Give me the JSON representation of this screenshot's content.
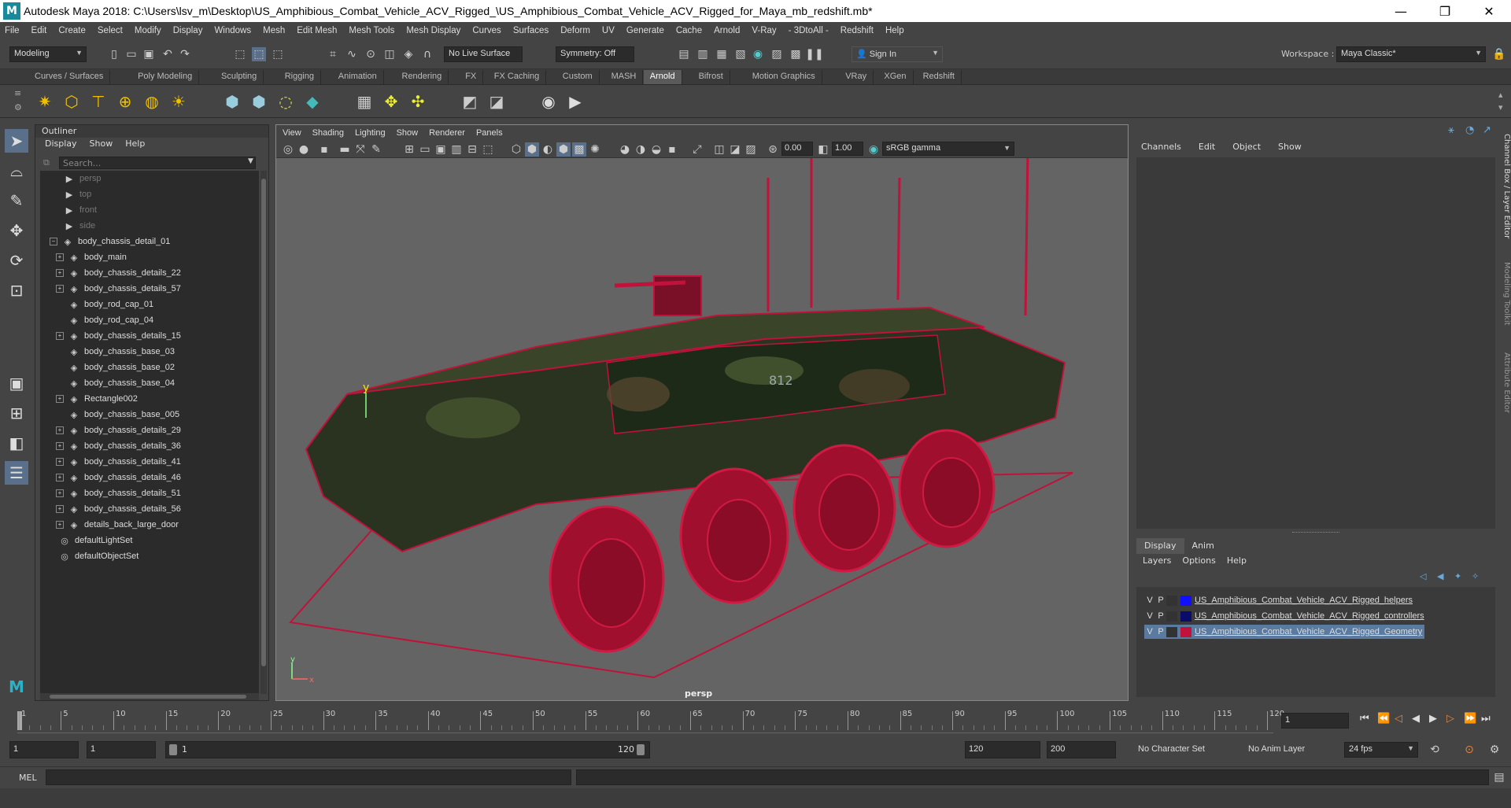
{
  "window": {
    "title": "Autodesk Maya 2018: C:\\Users\\lsv_m\\Desktop\\US_Amphibious_Combat_Vehicle_ACV_Rigged_\\US_Amphibious_Combat_Vehicle_ACV_Rigged_for_Maya_mb_redshift.mb*",
    "logo": "M",
    "minimize": "—",
    "restore": "❐",
    "close": "✕"
  },
  "menubar": [
    "File",
    "Edit",
    "Create",
    "Select",
    "Modify",
    "Display",
    "Windows",
    "Mesh",
    "Edit Mesh",
    "Mesh Tools",
    "Mesh Display",
    "Curves",
    "Surfaces",
    "Deform",
    "UV",
    "Generate",
    "Cache",
    "Arnold",
    "V-Ray",
    "- 3DtoAll -",
    "Redshift",
    "Help"
  ],
  "statusline": {
    "mode": "Modeling",
    "live_surface": "No Live Surface",
    "symmetry": "Symmetry: Off",
    "sign_in": "Sign In",
    "workspace_label": "Workspace :",
    "workspace_value": "Maya Classic*"
  },
  "shelf_tabs": [
    "Curves / Surfaces",
    "Poly Modeling",
    "Sculpting",
    "Rigging",
    "Animation",
    "Rendering",
    "FX",
    "FX Caching",
    "Custom",
    "MASH",
    "Arnold",
    "Bifrost",
    "Motion Graphics",
    "VRay",
    "XGen",
    "Redshift"
  ],
  "shelf_active": "Arnold",
  "outliner": {
    "title": "Outliner",
    "menu": [
      "Display",
      "Show",
      "Help"
    ],
    "search_placeholder": "Search...",
    "items": [
      {
        "label": "persp",
        "kind": "camera",
        "dim": true,
        "indent": 0,
        "expand": false
      },
      {
        "label": "top",
        "kind": "camera",
        "dim": true,
        "indent": 0,
        "expand": false
      },
      {
        "label": "front",
        "kind": "camera",
        "dim": true,
        "indent": 0,
        "expand": false
      },
      {
        "label": "side",
        "kind": "camera",
        "dim": true,
        "indent": 0,
        "expand": false
      },
      {
        "label": "body_chassis_detail_01",
        "kind": "group",
        "dim": false,
        "indent": 0,
        "expand": true,
        "expand_sign": "−"
      },
      {
        "label": "body_main",
        "kind": "group",
        "dim": false,
        "indent": 1,
        "expand": true,
        "expand_sign": "+"
      },
      {
        "label": "body_chassis_details_22",
        "kind": "group",
        "dim": false,
        "indent": 1,
        "expand": true,
        "expand_sign": "+"
      },
      {
        "label": "body_chassis_details_57",
        "kind": "group",
        "dim": false,
        "indent": 1,
        "expand": true,
        "expand_sign": "+"
      },
      {
        "label": "body_rod_cap_01",
        "kind": "group",
        "dim": false,
        "indent": 1,
        "expand": false
      },
      {
        "label": "body_rod_cap_04",
        "kind": "group",
        "dim": false,
        "indent": 1,
        "expand": false
      },
      {
        "label": "body_chassis_details_15",
        "kind": "group",
        "dim": false,
        "indent": 1,
        "expand": true,
        "expand_sign": "+"
      },
      {
        "label": "body_chassis_base_03",
        "kind": "group",
        "dim": false,
        "indent": 1,
        "expand": false
      },
      {
        "label": "body_chassis_base_02",
        "kind": "group",
        "dim": false,
        "indent": 1,
        "expand": false
      },
      {
        "label": "body_chassis_base_04",
        "kind": "group",
        "dim": false,
        "indent": 1,
        "expand": false
      },
      {
        "label": "Rectangle002",
        "kind": "group",
        "dim": false,
        "indent": 1,
        "expand": true,
        "expand_sign": "+"
      },
      {
        "label": "body_chassis_base_005",
        "kind": "group",
        "dim": false,
        "indent": 1,
        "expand": false
      },
      {
        "label": "body_chassis_details_29",
        "kind": "group",
        "dim": false,
        "indent": 1,
        "expand": true,
        "expand_sign": "+"
      },
      {
        "label": "body_chassis_details_36",
        "kind": "group",
        "dim": false,
        "indent": 1,
        "expand": true,
        "expand_sign": "+"
      },
      {
        "label": "body_chassis_details_41",
        "kind": "group",
        "dim": false,
        "indent": 1,
        "expand": true,
        "expand_sign": "+"
      },
      {
        "label": "body_chassis_details_46",
        "kind": "group",
        "dim": false,
        "indent": 1,
        "expand": true,
        "expand_sign": "+"
      },
      {
        "label": "body_chassis_details_51",
        "kind": "group",
        "dim": false,
        "indent": 1,
        "expand": true,
        "expand_sign": "+"
      },
      {
        "label": "body_chassis_details_56",
        "kind": "group",
        "dim": false,
        "indent": 1,
        "expand": true,
        "expand_sign": "+"
      },
      {
        "label": "details_back_large_door",
        "kind": "group",
        "dim": false,
        "indent": 1,
        "expand": true,
        "expand_sign": "+"
      },
      {
        "label": "defaultLightSet",
        "kind": "set",
        "dim": false,
        "indent": 0,
        "expand": false
      },
      {
        "label": "defaultObjectSet",
        "kind": "set",
        "dim": false,
        "indent": 0,
        "expand": false
      }
    ]
  },
  "viewport": {
    "menu": [
      "View",
      "Shading",
      "Lighting",
      "Show",
      "Renderer",
      "Panels"
    ],
    "exposure": "0.00",
    "gamma": "1.00",
    "color_space": "sRGB gamma",
    "camera_label": "persp",
    "axis_y": "y",
    "axis_x": "x",
    "wire_color": "#c0123a",
    "fleet_mark": "812"
  },
  "channelbox": {
    "menu": [
      "Channels",
      "Edit",
      "Object",
      "Show"
    ],
    "tabs": [
      "Display",
      "Anim"
    ],
    "active_tab": "Display",
    "layer_menu": [
      "Layers",
      "Options",
      "Help"
    ],
    "layers": [
      {
        "v": "V",
        "p": "P",
        "color": "#1010ff",
        "name": "US_Amphibious_Combat_Vehicle_ACV_Rigged_helpers",
        "selected": false
      },
      {
        "v": "V",
        "p": "P",
        "color": "#0b0b6a",
        "name": "US_Amphibious_Combat_Vehicle_ACV_Rigged_controllers",
        "selected": false
      },
      {
        "v": "V",
        "p": "P",
        "color": "#c0123a",
        "name": "US_Amphibious_Combat_Vehicle_ACV_Rigged_Geometry",
        "selected": true
      }
    ],
    "side_tabs": [
      "Channel Box / Layer Editor",
      "Modeling Toolkit",
      "Attribute Editor"
    ]
  },
  "timeline": {
    "ticks": [
      "1",
      "5",
      "10",
      "15",
      "20",
      "25",
      "30",
      "35",
      "40",
      "45",
      "50",
      "55",
      "60",
      "65",
      "70",
      "75",
      "80",
      "85",
      "90",
      "95",
      "100",
      "105",
      "110",
      "115",
      "120"
    ],
    "current_frame": "1"
  },
  "range": {
    "start": "1",
    "playback_start": "1",
    "slider_start": "1",
    "slider_end": "120",
    "playback_end": "120",
    "end": "200",
    "character_set": "No Character Set",
    "anim_layer": "No Anim Layer",
    "fps": "24 fps"
  },
  "cmdline": {
    "label": "MEL"
  }
}
